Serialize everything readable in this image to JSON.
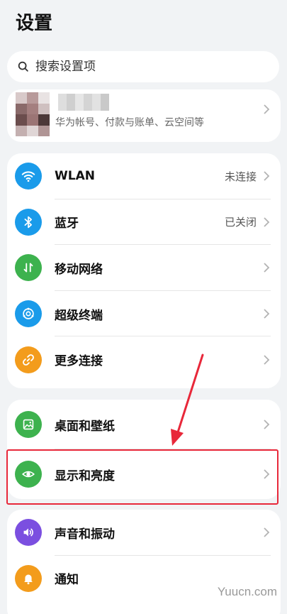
{
  "header": {
    "title": "设置"
  },
  "search": {
    "placeholder": "搜索设置项"
  },
  "account": {
    "subtitle": "华为帐号、付款与账单、云空间等"
  },
  "groups": [
    {
      "items": [
        {
          "label": "WLAN",
          "status": "未连接",
          "icon": "wifi-icon",
          "color": "#1a9bea"
        },
        {
          "label": "蓝牙",
          "status": "已关闭",
          "icon": "bluetooth-icon",
          "color": "#1a9bea"
        },
        {
          "label": "移动网络",
          "status": "",
          "icon": "mobile-data-icon",
          "color": "#3db24e"
        },
        {
          "label": "超级终端",
          "status": "",
          "icon": "super-device-icon",
          "color": "#1a9bea"
        },
        {
          "label": "更多连接",
          "status": "",
          "icon": "link-icon",
          "color": "#f39c1c"
        }
      ]
    },
    {
      "items": [
        {
          "label": "桌面和壁纸",
          "status": "",
          "icon": "wallpaper-icon",
          "color": "#3db24e"
        },
        {
          "label": "显示和亮度",
          "status": "",
          "icon": "eye-icon",
          "color": "#3db24e"
        }
      ]
    },
    {
      "items": [
        {
          "label": "声音和振动",
          "status": "",
          "icon": "speaker-icon",
          "color": "#7b4fe0"
        },
        {
          "label": "通知",
          "status": "",
          "icon": "bell-icon",
          "color": "#f39c1c"
        }
      ]
    }
  ],
  "watermark": "Yuucn.com",
  "annotation_color": "#e8283a"
}
